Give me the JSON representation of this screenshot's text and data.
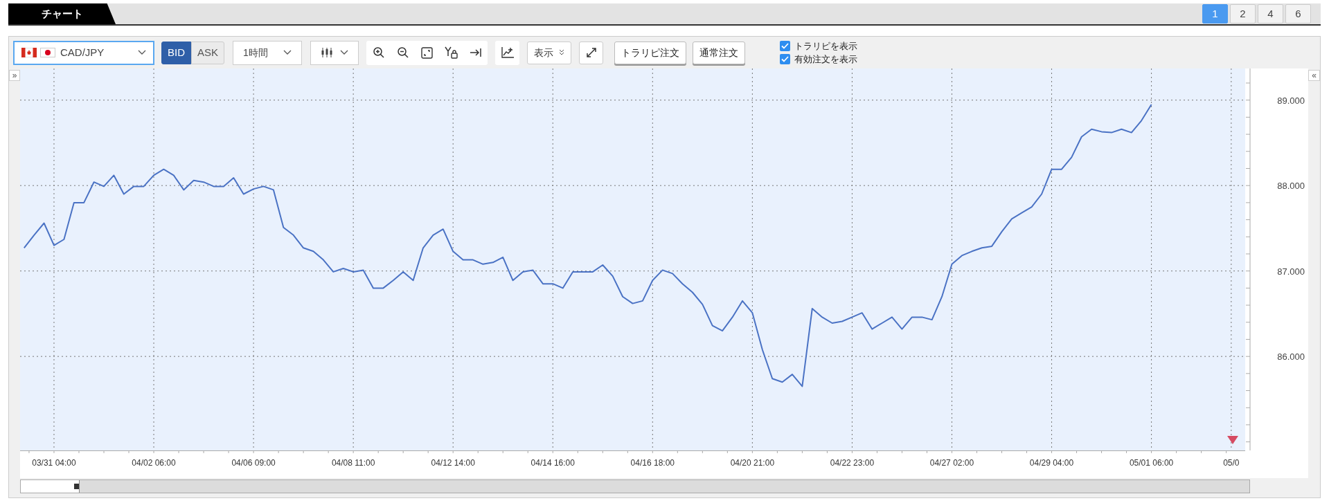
{
  "tab": {
    "label": "チャート",
    "selected": true
  },
  "layouts": [
    {
      "label": "1",
      "selected": true
    },
    {
      "label": "2",
      "selected": false
    },
    {
      "label": "4",
      "selected": false
    },
    {
      "label": "6",
      "selected": false
    }
  ],
  "toolbar": {
    "symbol": "CAD/JPY",
    "price_sides": [
      {
        "label": "BID",
        "selected": true
      },
      {
        "label": "ASK",
        "selected": false
      }
    ],
    "timeframe": "1時間",
    "display_button": "表示",
    "order_buttons": [
      "トラリピ注文",
      "通常注文"
    ],
    "options": [
      {
        "label": "トラリピを表示",
        "checked": true
      },
      {
        "label": "有効注文を表示",
        "checked": true
      }
    ]
  },
  "left_collapse": "»",
  "right_collapse": "«",
  "chart": {
    "chart_data": {
      "type": "line",
      "grid": true,
      "ylim": [
        84.9,
        89.37
      ],
      "categories": [
        null,
        null,
        null,
        "03/31 04:00",
        null,
        null,
        null,
        null,
        null,
        null,
        null,
        null,
        null,
        "04/02 06:00",
        null,
        null,
        null,
        null,
        null,
        null,
        null,
        null,
        null,
        "04/06 09:00",
        null,
        null,
        null,
        null,
        null,
        null,
        null,
        null,
        null,
        "04/08 11:00",
        null,
        null,
        null,
        null,
        null,
        null,
        null,
        null,
        null,
        "04/12 14:00",
        null,
        null,
        null,
        null,
        null,
        null,
        null,
        null,
        null,
        "04/14 16:00",
        null,
        null,
        null,
        null,
        null,
        null,
        null,
        null,
        null,
        "04/16 18:00",
        null,
        null,
        null,
        null,
        null,
        null,
        null,
        null,
        null,
        "04/20 21:00",
        null,
        null,
        null,
        null,
        null,
        null,
        null,
        null,
        null,
        "04/22 23:00",
        null,
        null,
        null,
        null,
        null,
        null,
        null,
        null,
        null,
        "04/27 02:00",
        null,
        null,
        null,
        null,
        null,
        null,
        null,
        null,
        null,
        "04/29 04:00",
        null,
        null,
        null,
        null,
        null,
        null,
        null,
        null,
        null,
        "05/01 06:00",
        null,
        null,
        null,
        null,
        null,
        null,
        null,
        "05/0",
        null
      ],
      "yticks": [
        {
          "value": 86,
          "label": "86.000"
        },
        {
          "value": 87,
          "label": "87.000"
        },
        {
          "value": 88,
          "label": "88.000"
        },
        {
          "value": 89,
          "label": "89.000"
        }
      ],
      "series": [
        {
          "color": "#4a72c4",
          "values": [
            87.27,
            87.42,
            87.56,
            87.3,
            87.37,
            87.8,
            87.8,
            88.04,
            87.99,
            88.12,
            87.9,
            87.99,
            87.99,
            88.12,
            88.19,
            88.12,
            87.95,
            88.06,
            88.04,
            87.99,
            87.99,
            88.09,
            87.9,
            87.96,
            87.99,
            87.95,
            87.51,
            87.42,
            87.27,
            87.23,
            87.13,
            86.99,
            87.03,
            86.99,
            87.01,
            86.8,
            86.8,
            86.89,
            86.99,
            86.89,
            87.27,
            87.42,
            87.49,
            87.23,
            87.13,
            87.13,
            87.08,
            87.1,
            87.16,
            86.89,
            86.99,
            87.01,
            86.85,
            86.85,
            86.8,
            86.99,
            86.99,
            86.99,
            87.07,
            86.94,
            86.7,
            86.62,
            86.65,
            86.89,
            87.01,
            86.97,
            86.85,
            86.75,
            86.61,
            86.36,
            86.3,
            86.46,
            86.65,
            86.51,
            86.08,
            85.74,
            85.7,
            85.79,
            85.65,
            86.56,
            86.46,
            86.39,
            86.41,
            86.46,
            86.51,
            86.32,
            86.39,
            86.46,
            86.32,
            86.46,
            86.46,
            86.43,
            86.7,
            87.08,
            87.18,
            87.23,
            87.27,
            87.29,
            87.46,
            87.61,
            87.68,
            87.75,
            87.9,
            88.19,
            88.19,
            88.33,
            88.57,
            88.66,
            88.63,
            88.62,
            88.66,
            88.62,
            88.76,
            88.95,
            null,
            null,
            null,
            null,
            null,
            null,
            null,
            null,
            null
          ]
        }
      ]
    }
  }
}
